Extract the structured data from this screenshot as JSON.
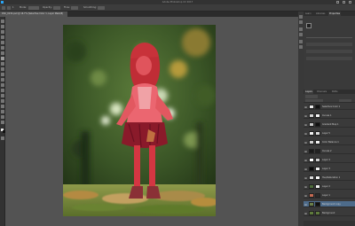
{
  "colors": {
    "app_bg": "#535353",
    "menubar_bg": "#323232",
    "panel_bg": "#3a3a3a",
    "selection_blue": "#4d6b8a",
    "quick_mask_red": "#ff3c46",
    "brand_blue": "#2aa4f4"
  },
  "icons": {
    "app": "photoshop-logo-icon",
    "visibility": "eye-icon",
    "window_minimize": "minimize-icon",
    "window_maximize": "maximize-icon",
    "window_close": "close-icon"
  },
  "window": {
    "title": "Adobe Photoshop CC 2017"
  },
  "options_bar": {
    "size_value": "1",
    "mode_label": "Mode:",
    "opacity_label": "Opacity:",
    "flow_label": "Flow:",
    "smoothing_label": "Smoothing:"
  },
  "document": {
    "tab_label": "DSC_0132.psd @ 16.7% (Selective Color 1, Layer Mask/8)"
  },
  "panels": {
    "top_tabs": [
      "Learn",
      "Libraries",
      "Properties"
    ],
    "layer_tabs": [
      "Layers",
      "Channels",
      "Paths"
    ],
    "layers": [
      {
        "name": "Selective Color 1",
        "selected": false
      },
      {
        "name": "Curves 1",
        "selected": false
      },
      {
        "name": "Gradient Map 1",
        "selected": false
      },
      {
        "name": "Layer 5",
        "selected": false
      },
      {
        "name": "Color Balance 1",
        "selected": false
      },
      {
        "name": "Curves 2",
        "selected": false
      },
      {
        "name": "Layer 4",
        "selected": false
      },
      {
        "name": "Layer 3",
        "selected": false
      },
      {
        "name": "Hue/Saturation 1",
        "selected": false
      },
      {
        "name": "Layer 2",
        "selected": false
      },
      {
        "name": "Layer 1",
        "selected": false
      },
      {
        "name": "Background copy",
        "selected": true
      },
      {
        "name": "Background",
        "selected": false
      }
    ]
  },
  "canvas": {
    "quick_mask_subject": "girl-in-autumn-leaves"
  }
}
